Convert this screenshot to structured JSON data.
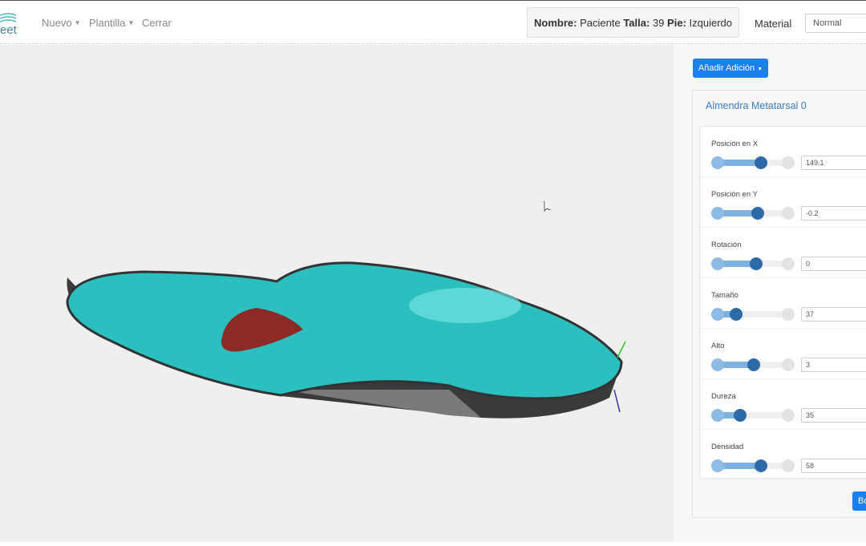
{
  "nav": {
    "logo_text": "eet",
    "items": [
      {
        "label": "Nuevo",
        "dropdown": true
      },
      {
        "label": "Plantilla",
        "dropdown": true
      },
      {
        "label": "Cerrar",
        "dropdown": false
      }
    ]
  },
  "patient": {
    "name_label": "Nombre:",
    "name": "Paciente",
    "size_label": "Talla:",
    "size": "39",
    "foot_label": "Pie:",
    "foot": "Izquierdo"
  },
  "material": {
    "label": "Material",
    "value": "Normal"
  },
  "panel": {
    "add_button": "Añadir Adición",
    "card_title": "Almendra Metatarsal 0",
    "footer_button": "Bo",
    "params": [
      {
        "label": "Posición en X",
        "value": "149.1",
        "level": 0.58
      },
      {
        "label": "Posición en Y",
        "value": "-0.2",
        "level": 0.52
      },
      {
        "label": "Rotación",
        "value": "0",
        "level": 0.5
      },
      {
        "label": "Tamaño",
        "value": "37",
        "level": 0.19
      },
      {
        "label": "Alto",
        "value": "3",
        "level": 0.46
      },
      {
        "label": "Dureza",
        "value": "35",
        "level": 0.25
      },
      {
        "label": "Densidad",
        "value": "58",
        "level": 0.57
      }
    ]
  },
  "colors": {
    "accent": "#1a7ff0",
    "insole": "#2bbfbf",
    "pad": "#8b2a26"
  }
}
